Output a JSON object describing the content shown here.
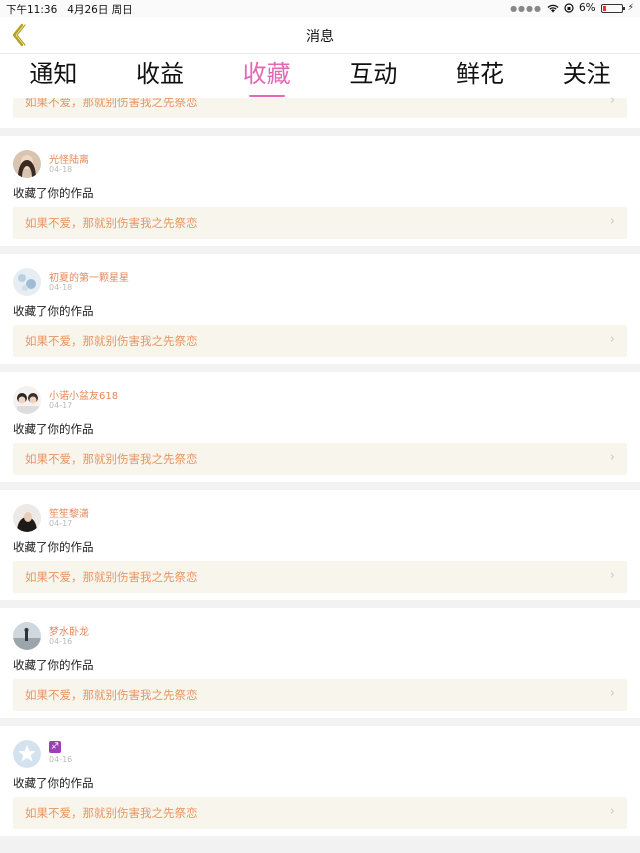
{
  "status_bar": {
    "time": "下午11:36",
    "date": "4月26日 周日",
    "battery": "6%"
  },
  "nav": {
    "title": "消息"
  },
  "tabs": [
    {
      "label": "通知"
    },
    {
      "label": "收益"
    },
    {
      "label": "收藏"
    },
    {
      "label": "互动"
    },
    {
      "label": "鲜花"
    },
    {
      "label": "关注"
    }
  ],
  "active_tab_index": 2,
  "colors": {
    "accent_pink": "#e667b3",
    "name_orange": "#e6885a",
    "quote_text": "#e89562",
    "quote_bg": "#f7f5ec",
    "back_gold": "#b8a11a"
  },
  "partial_quote": "如果不爱，那就别伤害我之先祭恋",
  "items": [
    {
      "name": "光怪陆离",
      "date": "04-18",
      "action": "收藏了你的作品",
      "quote": "如果不爱，那就别伤害我之先祭恋",
      "avatar": "photo-girl"
    },
    {
      "name": "初夏的第一颗星星",
      "date": "04-18",
      "action": "收藏了你的作品",
      "quote": "如果不爱，那就别伤害我之先祭恋",
      "avatar": "photo-snow"
    },
    {
      "name": "小诺小盆友618",
      "date": "04-17",
      "action": "收藏了你的作品",
      "quote": "如果不爱，那就别伤害我之先祭恋",
      "avatar": "photo-boys"
    },
    {
      "name": "笙笙黎潇",
      "date": "04-17",
      "action": "收藏了你的作品",
      "quote": "如果不爱，那就别伤害我之先祭恋",
      "avatar": "photo-dark"
    },
    {
      "name": "梦水卧龙",
      "date": "04-16",
      "action": "收藏了你的作品",
      "quote": "如果不爱，那就别伤害我之先祭恋",
      "avatar": "photo-beach"
    },
    {
      "name": "♐",
      "date": "04-16",
      "action": "收藏了你的作品",
      "quote": "如果不爱，那就别伤害我之先祭恋",
      "avatar": "default-star"
    }
  ]
}
